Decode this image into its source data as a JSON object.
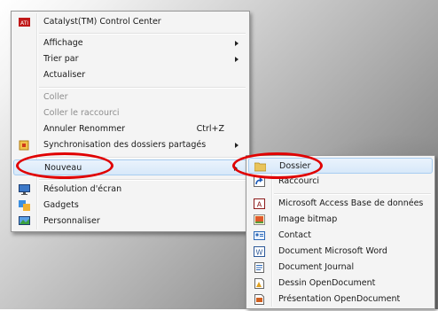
{
  "context_menu": {
    "items": [
      {
        "label": "Catalyst(TM) Control Center",
        "icon": "ati-icon"
      },
      {
        "label": "Affichage",
        "submenu": true
      },
      {
        "label": "Trier par",
        "submenu": true
      },
      {
        "label": "Actualiser"
      },
      {
        "label": "Coller",
        "disabled": true
      },
      {
        "label": "Coller le raccourci",
        "disabled": true
      },
      {
        "label": "Annuler Renommer",
        "shortcut": "Ctrl+Z"
      },
      {
        "label": "Synchronisation des dossiers partagés",
        "icon": "sync-icon",
        "submenu": true
      },
      {
        "label": "Nouveau",
        "submenu": true,
        "highlighted": true
      },
      {
        "label": "Résolution d'écran",
        "icon": "monitor-icon"
      },
      {
        "label": "Gadgets",
        "icon": "gadgets-icon"
      },
      {
        "label": "Personnaliser",
        "icon": "personalize-icon"
      }
    ]
  },
  "submenu": {
    "items": [
      {
        "label": "Dossier",
        "icon": "folder-icon",
        "highlighted": true
      },
      {
        "label": "Raccourci",
        "icon": "shortcut-icon"
      },
      {
        "label": "Microsoft Access Base de données",
        "icon": "access-icon"
      },
      {
        "label": "Image bitmap",
        "icon": "bitmap-icon"
      },
      {
        "label": "Contact",
        "icon": "contact-icon"
      },
      {
        "label": "Document Microsoft Word",
        "icon": "word-icon"
      },
      {
        "label": "Document Journal",
        "icon": "journal-icon"
      },
      {
        "label": "Dessin OpenDocument",
        "icon": "od-drawing-icon"
      },
      {
        "label": "Présentation OpenDocument",
        "icon": "od-presentation-icon"
      }
    ]
  },
  "colors": {
    "annotation": "#e00000",
    "highlight": "#d7e8f9"
  }
}
